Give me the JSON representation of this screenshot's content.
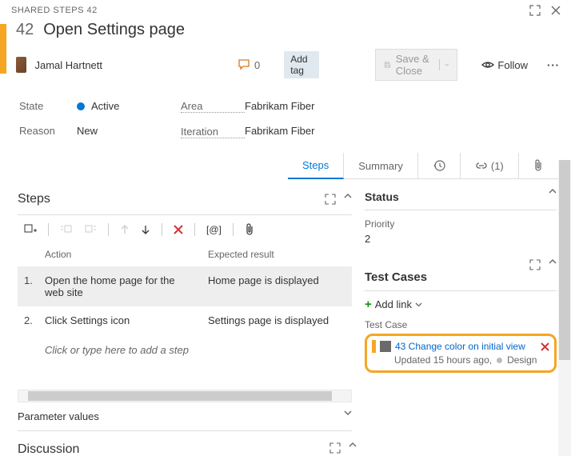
{
  "window": {
    "type_id": "SHARED STEPS 42",
    "id": "42",
    "title": "Open Settings page"
  },
  "user": {
    "name": "Jamal Hartnett"
  },
  "discussion_count": "0",
  "add_tag": "Add tag",
  "save_close": "Save & Close",
  "follow": "Follow",
  "fields": {
    "state_label": "State",
    "state_value": "Active",
    "reason_label": "Reason",
    "reason_value": "New",
    "area_label": "Area",
    "area_value": "Fabrikam Fiber",
    "iteration_label": "Iteration",
    "iteration_value": "Fabrikam Fiber"
  },
  "tabs": {
    "steps": "Steps",
    "summary": "Summary",
    "links_count": "(1)"
  },
  "steps_section": {
    "title": "Steps",
    "col_action": "Action",
    "col_expected": "Expected result",
    "rows": [
      {
        "num": "1.",
        "action": "Open the home page for the web site",
        "expected": "Home page is displayed"
      },
      {
        "num": "2.",
        "action": "Click Settings icon",
        "expected": "Settings page is displayed"
      }
    ],
    "placeholder": "Click or type here to add a step"
  },
  "param_values": "Parameter values",
  "discussion": "Discussion",
  "status": {
    "title": "Status",
    "priority_label": "Priority",
    "priority_value": "2"
  },
  "test_cases": {
    "title": "Test Cases",
    "add_link": "Add link",
    "label": "Test Case",
    "item": {
      "id_title": "43 Change color on initial view",
      "updated": "Updated 15 hours ago,",
      "state": "Design"
    }
  },
  "toolbar_format": "[@]"
}
